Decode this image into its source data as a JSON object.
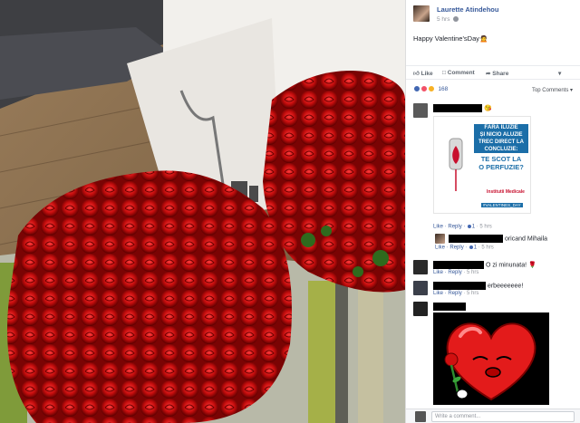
{
  "post": {
    "author": "Laurette Atindehou",
    "time": "5 hrs",
    "caption": "Happy Valentine'sDay🙍"
  },
  "actions": {
    "like": "Like",
    "comment": "Comment",
    "share": "Share"
  },
  "reactions": {
    "count": "168",
    "sort": "Top Comments ▾"
  },
  "comments": [
    {
      "text": "😘",
      "like": "Like",
      "reply": "Reply",
      "reaction_count": "1",
      "time": "5 hrs",
      "ad": {
        "line1": "FĂRĂ ILUZIE",
        "line2": "ȘI NICIO ALUZIE",
        "line3": "TREC DIRECT LA",
        "line4": "CONCLUZIE:",
        "line5": "TE SCOT LA",
        "line6": "O PERFUZIE?",
        "brand": "Institutii Medicale",
        "tag": "#VALENTINES_DAY"
      }
    },
    {
      "text": "oricand Mihaila",
      "like": "Like",
      "reply": "Reply",
      "reaction_count": "1",
      "time": "5 hrs"
    },
    {
      "text": "O zi minunata! 🌹",
      "like": "Like",
      "reply": "Reply",
      "time": "5 hrs"
    },
    {
      "text": "erbeeeeeee!",
      "like": "Like",
      "reply": "Reply",
      "time": "5 hrs"
    }
  ],
  "write_placeholder": "Write a comment...",
  "colors": {
    "link": "#365899",
    "fb_blue": "#4267b2",
    "meta_gray": "#90949c"
  }
}
